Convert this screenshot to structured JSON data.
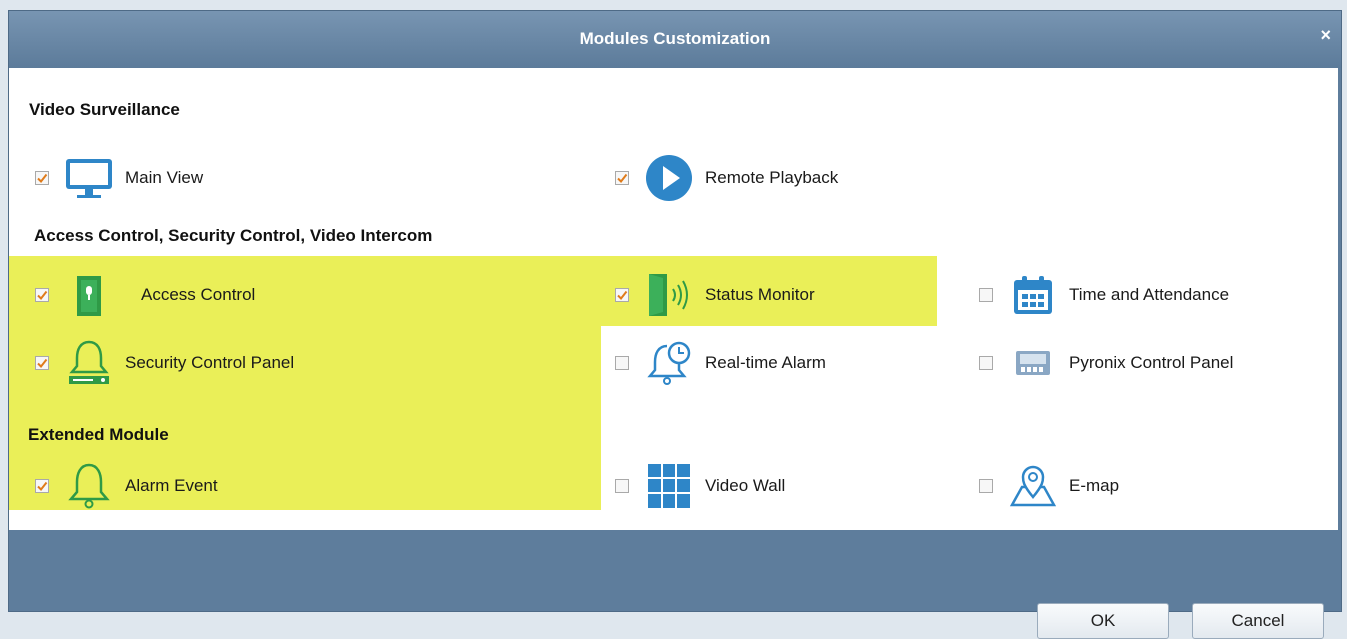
{
  "dialog": {
    "title": "Modules Customization",
    "close_glyph": "×"
  },
  "sections": {
    "video_surveillance": "Video Surveillance",
    "access_security": "Access Control, Security Control, Video Intercom",
    "extended": "Extended Module"
  },
  "modules": {
    "main_view": {
      "label": "Main View",
      "checked": true,
      "icon": "monitor-icon"
    },
    "remote_playback": {
      "label": "Remote Playback",
      "checked": true,
      "icon": "play-icon"
    },
    "access_control": {
      "label": "Access Control",
      "checked": true,
      "icon": "door-icon"
    },
    "status_monitor": {
      "label": "Status Monitor",
      "checked": true,
      "icon": "door-signal-icon"
    },
    "time_attendance": {
      "label": "Time and Attendance",
      "checked": false,
      "icon": "calendar-icon"
    },
    "security_panel": {
      "label": "Security Control Panel",
      "checked": true,
      "icon": "bell-panel-icon"
    },
    "realtime_alarm": {
      "label": "Real-time Alarm",
      "checked": false,
      "icon": "bell-clock-icon"
    },
    "pyronix_panel": {
      "label": "Pyronix Control Panel",
      "checked": false,
      "icon": "control-panel-icon"
    },
    "alarm_event": {
      "label": "Alarm Event",
      "checked": true,
      "icon": "bell-icon"
    },
    "video_wall": {
      "label": "Video Wall",
      "checked": false,
      "icon": "video-wall-icon"
    },
    "emap": {
      "label": "E-map",
      "checked": false,
      "icon": "map-pin-icon"
    }
  },
  "buttons": {
    "ok": "OK",
    "cancel": "Cancel"
  },
  "colors": {
    "highlight": "#eaef58",
    "header": "#5e7d9c",
    "check": "#e07b1a"
  }
}
